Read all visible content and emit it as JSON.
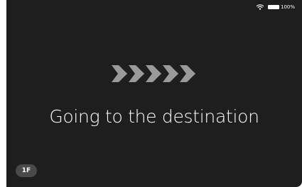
{
  "status_bar": {
    "wifi_icon": "wifi-icon",
    "battery_percent": 100,
    "battery_label": "100%"
  },
  "navigation": {
    "direction_icon": "chevrons-right-icon",
    "message": "Going to the destination"
  },
  "floor": {
    "label": "1F"
  },
  "colors": {
    "background": "#1e1e1e",
    "text": "#ffffff",
    "chevron": "#9a9a9a",
    "badge": "#4a4a4a"
  }
}
